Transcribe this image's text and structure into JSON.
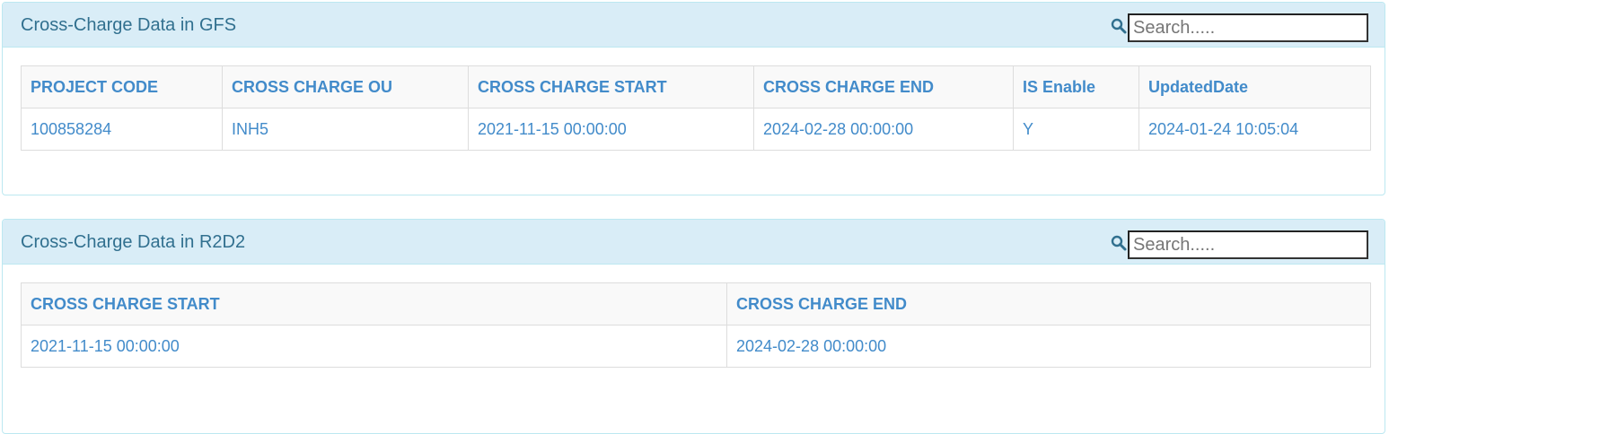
{
  "panels": [
    {
      "title": "Cross-Charge Data in GFS",
      "search_placeholder": "Search.....",
      "columns": [
        "PROJECT CODE",
        "CROSS CHARGE OU",
        "CROSS CHARGE START",
        "CROSS CHARGE END",
        "IS Enable",
        "UpdatedDate"
      ],
      "rows": [
        [
          "100858284",
          "INH5",
          "2021-11-15 00:00:00",
          "2024-02-28 00:00:00",
          "Y",
          "2024-01-24 10:05:04"
        ]
      ]
    },
    {
      "title": "Cross-Charge Data in R2D2",
      "search_placeholder": "Search.....",
      "columns": [
        "CROSS CHARGE START",
        "CROSS CHARGE END"
      ],
      "rows": [
        [
          "2021-11-15 00:00:00",
          "2024-02-28 00:00:00"
        ]
      ]
    }
  ],
  "colors": {
    "heading_bg": "#d9edf7",
    "heading_text": "#31708f",
    "table_text": "#428bca",
    "border": "#bce8f1"
  },
  "icons": {
    "search": "search-icon"
  }
}
